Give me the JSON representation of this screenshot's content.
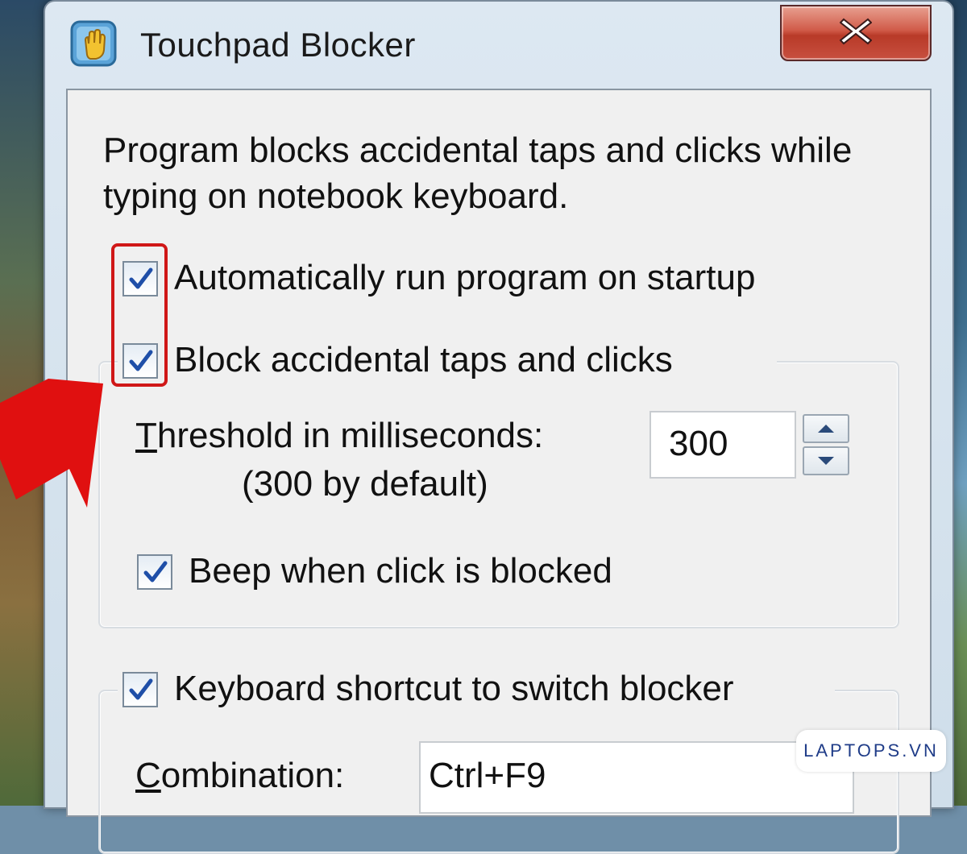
{
  "window": {
    "title": "Touchpad Blocker",
    "close_label": "close"
  },
  "description": "Program blocks accidental taps and clicks while typing on notebook keyboard.",
  "options": {
    "auto_run": {
      "label": "Automatically run program on startup",
      "checked": true
    },
    "block": {
      "label": "Block accidental taps and clicks",
      "checked": true
    }
  },
  "threshold": {
    "label_first_letter": "T",
    "label_rest": "hreshold in milliseconds:",
    "sublabel": "(300 by default)",
    "value": "300"
  },
  "beep": {
    "label": "Beep when click is blocked",
    "checked": true
  },
  "shortcut": {
    "label": "Keyboard shortcut to switch blocker",
    "checked": true,
    "combo_first_letter": "C",
    "combo_rest": "ombination:",
    "combo_value": "Ctrl+F9"
  },
  "watermark": "LAPTOPS.VN",
  "colors": {
    "highlight": "#d01818",
    "arrow": "#e01010",
    "check": "#1f4fa8"
  }
}
